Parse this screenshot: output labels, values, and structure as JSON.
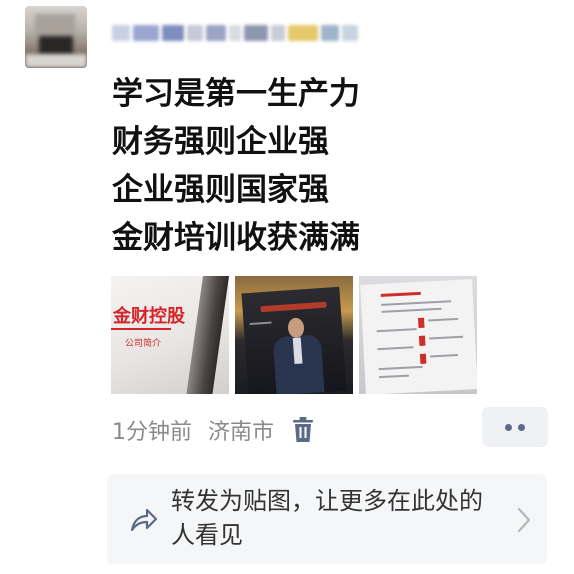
{
  "post": {
    "text_lines": [
      "学习是第一生产力",
      "财务强则企业强",
      "企业强则国家强",
      "金财培训收获满满"
    ],
    "photos": {
      "photo1": {
        "brand_text": "金财控股",
        "sub_text": "公司简介"
      }
    },
    "time": "1分钟前",
    "location": "济南市"
  },
  "share_box": {
    "text": "转发为贴图，让更多在此处的人看见"
  },
  "icons": {
    "trash": "trash-icon",
    "more": "more-dots-icon",
    "share": "share-arrow-icon",
    "chevron": "chevron-right-icon"
  },
  "colors": {
    "accent_link": "#5a6b88",
    "brand_red": "#d2262b"
  }
}
